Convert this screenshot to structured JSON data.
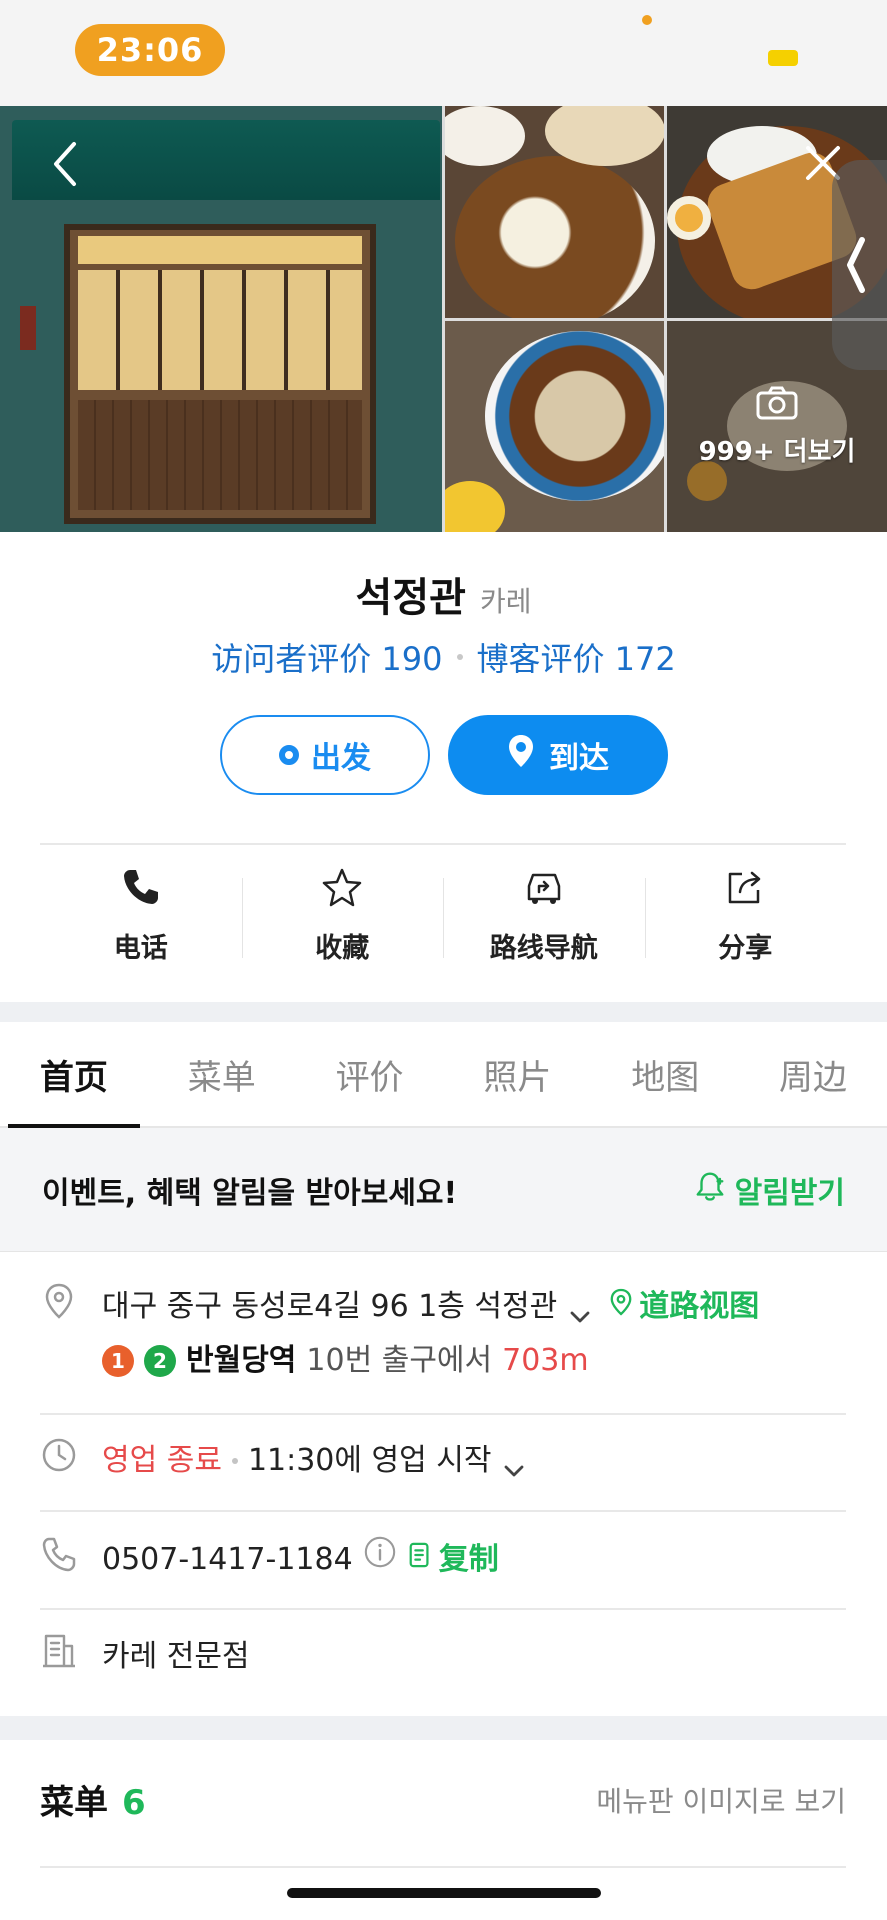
{
  "status_bar": {
    "time": "23:06"
  },
  "gallery": {
    "more_label": "999+ 더보기"
  },
  "place": {
    "name": "석정관",
    "category": "카레"
  },
  "reviews": {
    "visitor": "访问者评价 190",
    "blog": "博客评价 172"
  },
  "route_buttons": {
    "depart": "出发",
    "arrive": "到达"
  },
  "actions": [
    {
      "label": "电话",
      "icon": "phone-icon"
    },
    {
      "label": "收藏",
      "icon": "star-icon"
    },
    {
      "label": "路线导航",
      "icon": "route-icon"
    },
    {
      "label": "分享",
      "icon": "share-icon"
    }
  ],
  "tabs": [
    "首页",
    "菜单",
    "评价",
    "照片",
    "地图",
    "周边"
  ],
  "active_tab": "首页",
  "event": {
    "text": "이벤트, 혜택 알림을 받아보세요!",
    "cta": "알림받기"
  },
  "address": {
    "text": "대구 중구 동성로4길 96 1층 석정관",
    "street_view": "道路视图",
    "line_badges": [
      "1",
      "2"
    ],
    "station": "반월당역",
    "exit": "10번 출구에서",
    "distance": "703m"
  },
  "hours": {
    "status": "영업 종료",
    "next": "11:30에 영업 시작"
  },
  "phone": {
    "number": "0507-1417-1184",
    "copy": "复制"
  },
  "category_detail": "카레 전문점",
  "menu": {
    "title": "菜单",
    "count": "6",
    "image_link": "메뉴판 이미지로 보기"
  },
  "colors": {
    "accent_blue": "#0d8cf0",
    "green": "#1fb85a",
    "red": "#e64a4a",
    "time_pill": "#f0a020"
  }
}
